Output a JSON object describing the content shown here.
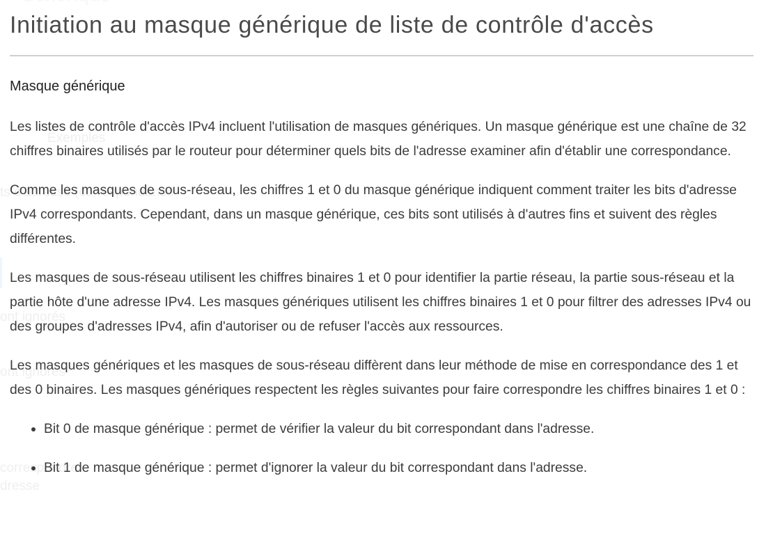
{
  "background_ghost": {
    "heading": "Générique",
    "lines": [
      "Exemples",
      "ts d'adresse (correspondance",
      "ont ignorés",
      "ont ignorés",
      "correspondre",
      "dresse"
    ]
  },
  "page": {
    "title": "Initiation au masque générique de liste de contrôle d'accès"
  },
  "section": {
    "heading": "Masque générique",
    "paragraphs": [
      "Les listes de contrôle d'accès IPv4 incluent l'utilisation de masques génériques. Un masque générique est une chaîne de 32 chiffres binaires utilisés par le routeur pour déterminer quels bits de l'adresse examiner afin d'établir une correspondance.",
      "Comme les masques de sous-réseau, les chiffres 1 et 0 du masque générique indiquent comment traiter les bits d'adresse IPv4 correspondants. Cependant, dans un masque générique, ces bits sont utilisés à d'autres fins et suivent des règles différentes.",
      "Les masques de sous-réseau utilisent les chiffres binaires 1 et 0 pour identifier la partie réseau, la partie sous-réseau et la partie hôte d'une adresse IPv4. Les masques génériques utilisent les chiffres binaires 1 et 0 pour filtrer des adresses IPv4 ou des groupes d'adresses IPv4, afin d'autoriser ou de refuser l'accès aux ressources.",
      "Les masques génériques et les masques de sous-réseau diffèrent dans leur méthode de mise en correspondance des 1 et des 0 binaires. Les masques génériques respectent les règles suivantes pour faire correspondre les chiffres binaires 1 et 0 :"
    ],
    "rules": [
      "Bit 0 de masque générique : permet de vérifier la valeur du bit correspondant dans l'adresse.",
      "Bit 1 de masque générique : permet d'ignorer la valeur du bit correspondant dans l'adresse."
    ]
  },
  "colors": {
    "text": "#3c3c3c",
    "divider": "#cfcfcf",
    "accent": "#1a7fd0"
  }
}
